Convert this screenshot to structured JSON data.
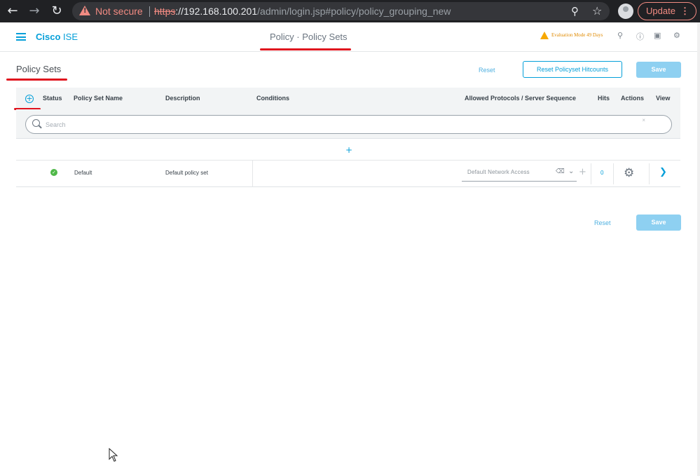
{
  "browser": {
    "back_icon": "arrow-left-icon",
    "forward_icon": "arrow-right-icon",
    "reload_icon": "reload-icon",
    "security_label": "Not secure",
    "url_scheme": "https",
    "url_sep": "://",
    "url_host": "192.168.100.201",
    "url_path": "/admin/login.jsp#policy/policy_grouping_new",
    "update_label": "Update"
  },
  "header": {
    "brand_bold": "Cisco",
    "brand_light": "ISE",
    "title": "Policy · Policy Sets",
    "evaluation": "Evaluation Mode 49 Days"
  },
  "page": {
    "title": "Policy Sets",
    "reset_label": "Reset",
    "reset_hitcounts_label": "Reset Policyset Hitcounts",
    "save_label": "Save",
    "bottom_reset_label": "Reset",
    "bottom_save_label": "Save"
  },
  "table": {
    "columns": {
      "status": "Status",
      "name": "Policy Set Name",
      "description": "Description",
      "conditions": "Conditions",
      "protocols": "Allowed Protocols / Server Sequence",
      "hits": "Hits",
      "actions": "Actions",
      "view": "View"
    },
    "search_placeholder": "Search",
    "rows": [
      {
        "status": "enabled",
        "name": "Default",
        "description": "Default policy set",
        "conditions": "",
        "protocol": "Default Network Access",
        "hits": "0"
      }
    ]
  },
  "colors": {
    "accent": "#049fd9",
    "save_disabled": "#8ed0f1",
    "status_ok": "#4fb848",
    "annotation_red": "#e0141e"
  }
}
